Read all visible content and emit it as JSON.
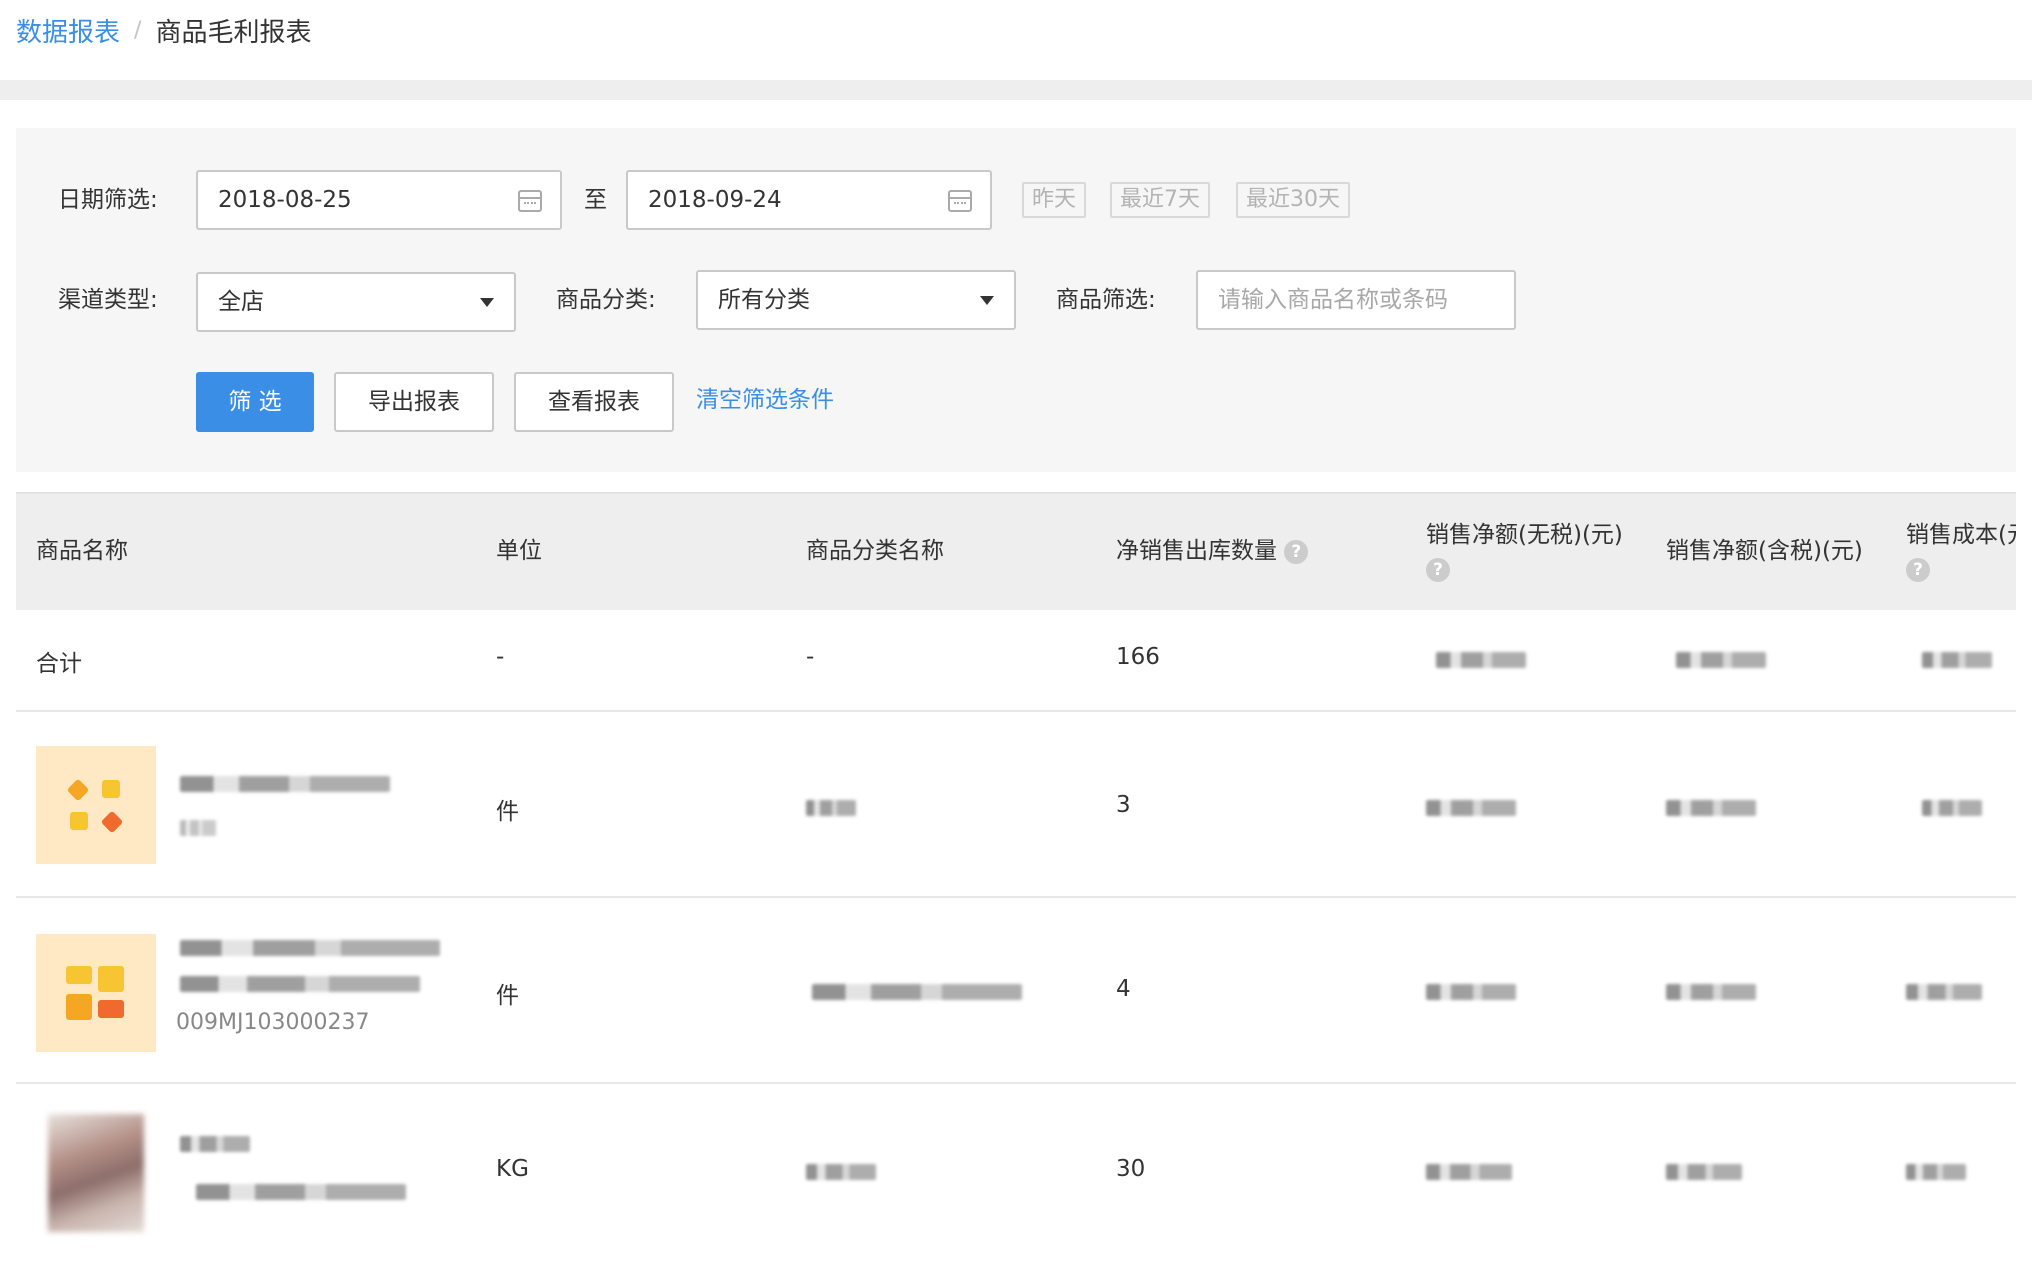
{
  "breadcrumb": {
    "parent": "数据报表",
    "separator": "/",
    "current": "商品毛利报表"
  },
  "filters": {
    "date_label": "日期筛选:",
    "date_start": "2018-08-25",
    "date_to": "至",
    "date_end": "2018-09-24",
    "quick_ranges": [
      "昨天",
      "最近7天",
      "最近30天"
    ],
    "channel_label": "渠道类型:",
    "channel_value": "全店",
    "category_label": "商品分类:",
    "category_value": "所有分类",
    "product_label": "商品筛选:",
    "product_placeholder": "请输入商品名称或条码"
  },
  "actions": {
    "filter": "筛 选",
    "export": "导出报表",
    "view": "查看报表",
    "clear": "清空筛选条件"
  },
  "table": {
    "columns": [
      "商品名称",
      "单位",
      "商品分类名称",
      "净销售出库数量",
      "销售净额(无税)(元)",
      "销售净额(含税)(元)",
      "销售成本(元)"
    ],
    "help_icon": "?",
    "total_row": {
      "name": "合计",
      "unit": "-",
      "category": "-",
      "qty": "166"
    },
    "rows": [
      {
        "unit": "件",
        "qty": "3",
        "thumb": "tag-bag-icon",
        "sku": ""
      },
      {
        "unit": "件",
        "qty": "4",
        "thumb": "puzzle-icon",
        "sku": "009MJ103000237"
      },
      {
        "unit": "KG",
        "qty": "30",
        "thumb": "product-photo",
        "sku": ""
      }
    ]
  },
  "colors": {
    "accent": "#3a8ee6",
    "header_bg": "#eeeeee",
    "panel_bg": "#f6f6f6",
    "thumb_bg": "#ffe8c4"
  }
}
